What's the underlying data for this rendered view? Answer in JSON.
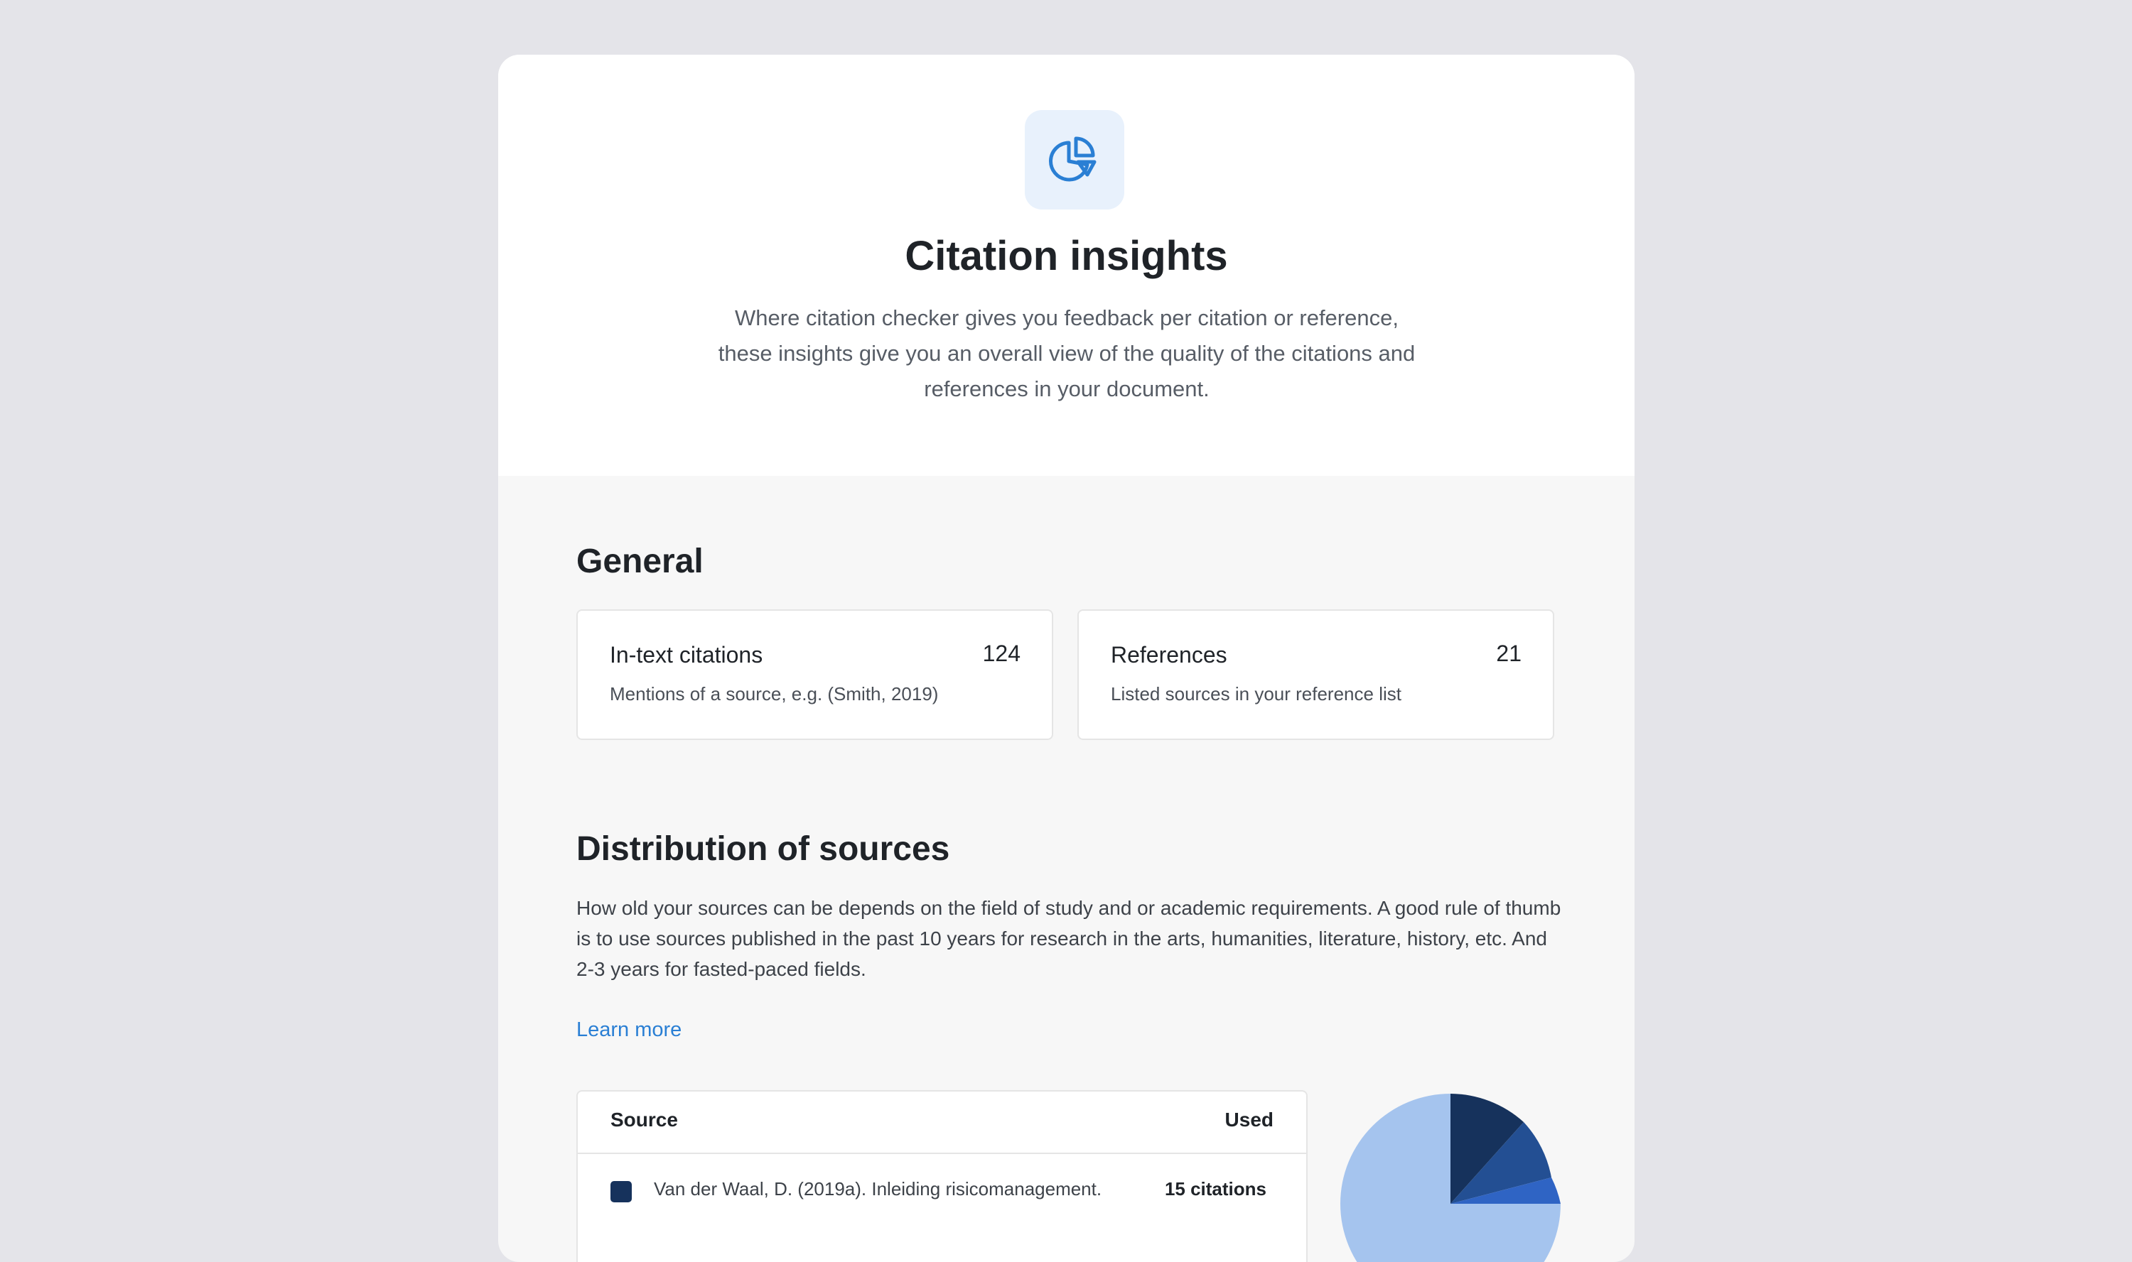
{
  "hero": {
    "title": "Citation insights",
    "description": "Where citation checker gives you feedback per citation or reference, these insights give you an overall view of the quality of the citations and references in your document.",
    "icon": "pie-chart-icon"
  },
  "general": {
    "title": "General",
    "cards": [
      {
        "label": "In-text citations",
        "value": "124",
        "sub": "Mentions of a source, e.g. (Smith, 2019)"
      },
      {
        "label": "References",
        "value": "21",
        "sub": "Listed sources in your reference list"
      }
    ]
  },
  "distribution": {
    "title": "Distribution of sources",
    "description": "How old your sources can be depends on the field of study and or academic requirements. A good rule of thumb is to use sources published in the past 10 years for research in the arts, humanities, literature, history, etc. And 2-3 years for fasted-paced fields.",
    "learn_more": "Learn more",
    "table": {
      "col_source": "Source",
      "col_used": "Used",
      "rows": [
        {
          "source": "Van der Waal, D. (2019a). Inleiding risicomanagement.",
          "used": "15 citations",
          "color": "#16325c"
        }
      ]
    }
  },
  "colors": {
    "accent": "#2a7fd4",
    "pie_dark": "#16325c",
    "pie_mid": "#234f93",
    "pie_blue": "#2f64c4",
    "pie_light": "#a5c4ee"
  }
}
